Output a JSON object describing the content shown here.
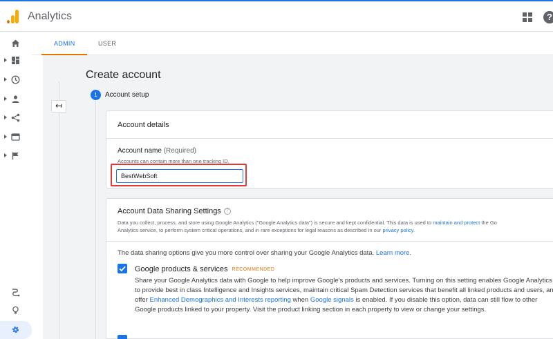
{
  "app": {
    "title": "Analytics",
    "accent": "#1a73e8",
    "brand": "#f9ab00"
  },
  "header": {
    "icons": [
      "apps-grid-icon",
      "help-icon"
    ],
    "help_glyph": "?"
  },
  "sidebar": {
    "items": [
      {
        "name": "home-icon"
      },
      {
        "name": "dashboard-icon"
      },
      {
        "name": "realtime-clock-icon"
      },
      {
        "name": "audience-person-icon"
      },
      {
        "name": "acquisition-icon"
      },
      {
        "name": "behavior-icon"
      },
      {
        "name": "conversions-flag-icon"
      },
      {
        "name": "attribution-icon"
      },
      {
        "name": "discover-bulb-icon"
      },
      {
        "name": "admin-gear-icon"
      }
    ]
  },
  "tabs": [
    {
      "label": "ADMIN",
      "active": true
    },
    {
      "label": "USER",
      "active": false
    }
  ],
  "back_glyph": "↤",
  "page": {
    "title": "Create account",
    "step": {
      "number": "1",
      "label": "Account setup"
    }
  },
  "account_details": {
    "title": "Account details",
    "field_label": "Account name",
    "field_required": "(Required)",
    "field_help": "Accounts can contain more than one tracking ID.",
    "field_value": "BestWebSoft"
  },
  "sharing": {
    "title": "Account Data Sharing Settings",
    "help_glyph": "?",
    "desc_line1_a": "Data you collect, process, and store using Google Analytics (\"Google Analytics data\") is secure and kept confidential. This data is used to ",
    "desc_line1_link": "maintain and protect",
    "desc_line1_b": " the Go",
    "desc_line2_a": "Analytics service, to perform system critical operations, and in rare exceptions for legal reasons as described in our ",
    "desc_line2_link": "privacy policy",
    "desc_line2_b": ".",
    "intro_text": "The data sharing options give you more control over sharing your Google Analytics data. ",
    "intro_link": "Learn more",
    "intro_end": ".",
    "option": {
      "title": "Google products & services",
      "badge": "RECOMMENDED",
      "checked": true,
      "desc_a": "Share your Google Analytics data with Google to help improve Google's products and services. Turning on this setting enables Google Analytics to provide best in class Intelligence and Insights services, maintain critical Spam Detection services that benefit all linked products and users, and offer ",
      "desc_link1": "Enhanced Demographics and Interests reporting",
      "desc_b": " when ",
      "desc_link2": "Google signals",
      "desc_c": " is enabled. If you disable this option, data can still flow to other Google products linked to your property. Visit the product linking section in each property to view or change your settings."
    }
  }
}
